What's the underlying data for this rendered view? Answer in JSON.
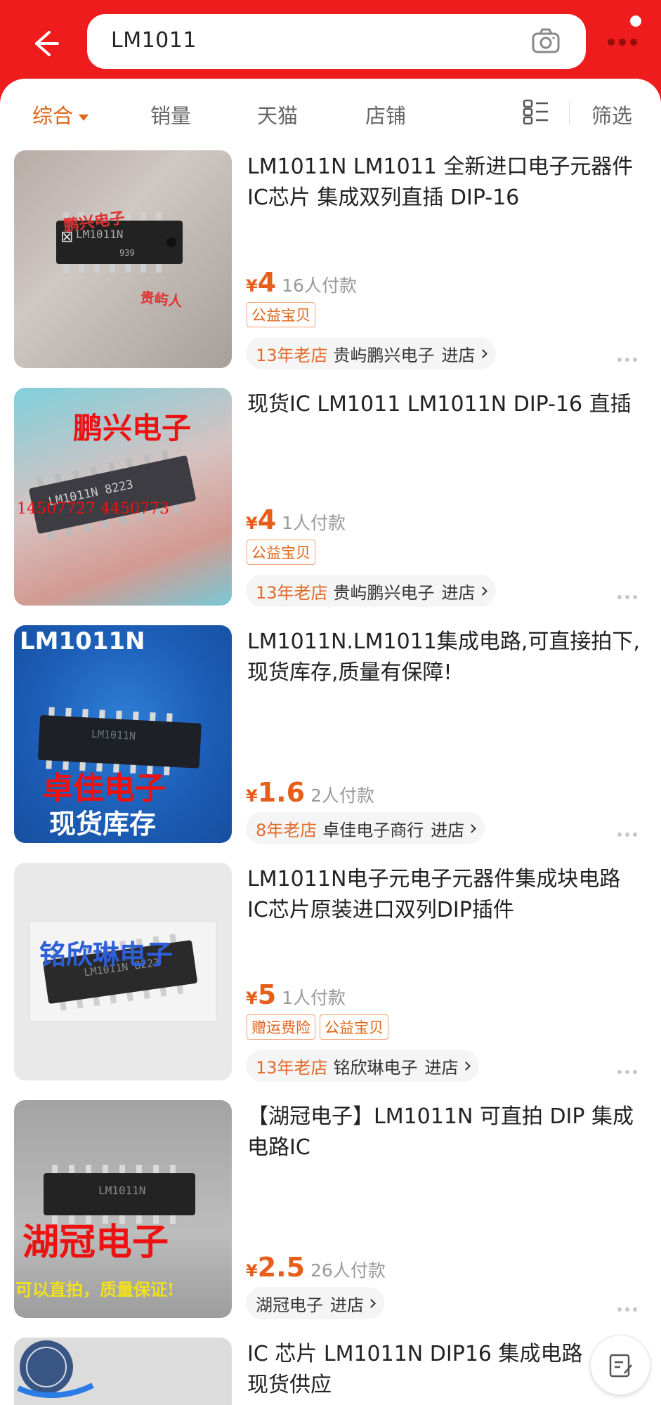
{
  "search": {
    "query": "LM1011"
  },
  "filters": {
    "tabs": [
      "综合",
      "销量",
      "天猫",
      "店铺"
    ],
    "filter_label": "筛选"
  },
  "products": [
    {
      "title": "LM1011N LM1011 全新进口电子元器件IC芯片 集成双列直插 DIP-16",
      "price": "4",
      "paid": "16人付款",
      "tags": [
        "公益宝贝"
      ],
      "shop_age": "13年老店",
      "shop_name": "贵屿鹏兴电子",
      "enter": "进店",
      "image_text": [
        "鹏兴电子",
        "LM1011N",
        "939",
        "贵屿人"
      ]
    },
    {
      "title": "现货IC LM1011 LM1011N DIP-16 直插",
      "price": "4",
      "paid": "1人付款",
      "tags": [
        "公益宝贝"
      ],
      "shop_age": "13年老店",
      "shop_name": "贵屿鹏兴电子",
      "enter": "进店",
      "image_text": [
        "鹏兴电子",
        "LM1011N 8223",
        "14507727 4450773"
      ]
    },
    {
      "title": "LM1011N.LM1011集成电路,可直接拍下,现货库存,质量有保障!",
      "price": "1.6",
      "paid": "2人付款",
      "tags": [],
      "shop_age": "8年老店",
      "shop_name": "卓佳电子商行",
      "enter": "进店",
      "image_text": [
        "LM1011N",
        "LM1011N",
        "卓佳电子",
        "现货库存"
      ]
    },
    {
      "title": "LM1011N电子元电子元器件集成块电路IC芯片原装进口双列DIP插件",
      "price": "5",
      "paid": "1人付款",
      "tags": [
        "赠运费险",
        "公益宝贝"
      ],
      "shop_age": "13年老店",
      "shop_name": "铭欣琳电子",
      "enter": "进店",
      "image_text": [
        "铭欣琳电子",
        "LM1011N 8223"
      ]
    },
    {
      "title": "【湖冠电子】LM1011N  可直拍 DIP 集成电路IC",
      "price": "2.5",
      "paid": "26人付款",
      "tags": [],
      "shop_age": "",
      "shop_name": "湖冠电子",
      "enter": "进店",
      "image_text": [
        "LM1011N",
        "湖冠电子",
        "可以直拍，质量保证!"
      ]
    },
    {
      "title": "IC 芯片 LM1011N DIP16 集成电路 现货供应"
    }
  ],
  "yen": "¥",
  "icons": {
    "back": "arrow-left-icon",
    "camera": "camera-icon",
    "more": "more-dots-icon",
    "list_toggle": "list-view-icon",
    "edit": "edit-note-icon"
  },
  "colors": {
    "brand": "#ee1c1c",
    "accent": "#e65e19"
  }
}
